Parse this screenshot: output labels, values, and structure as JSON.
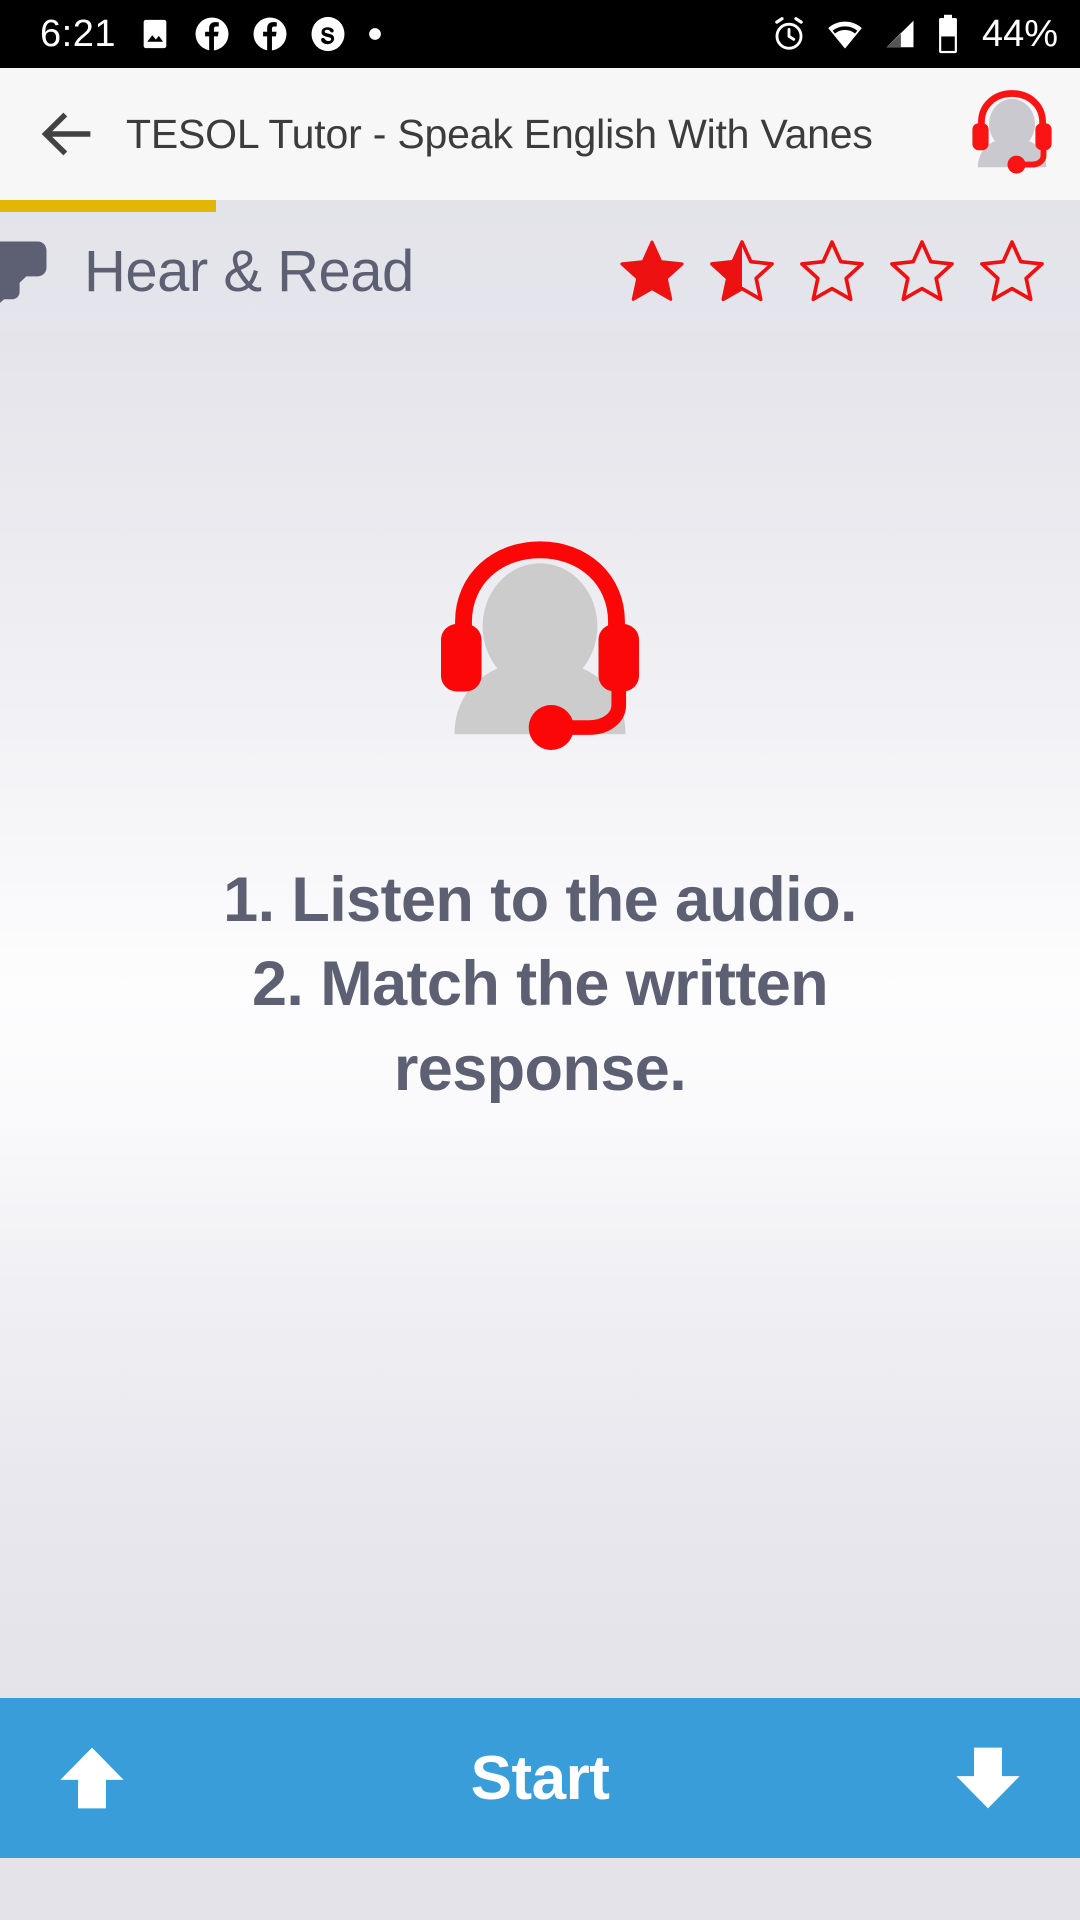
{
  "status_bar": {
    "time": "6:21",
    "battery_percent": "44%",
    "left_icons": [
      "image-icon",
      "facebook-icon",
      "facebook-icon",
      "skype-icon",
      "dot-icon"
    ],
    "right_icons": [
      "alarm-icon",
      "wifi-icon",
      "signal-icon",
      "battery-icon"
    ],
    "background_color": "#000000",
    "foreground_color": "#ffffff"
  },
  "app_bar": {
    "back_icon": "back-arrow-icon",
    "title": "TESOL Tutor - Speak English With Vanes",
    "avatar_icon": "headset-avatar-icon",
    "background_color": "#f7f7f7",
    "title_color": "#3c3c3c"
  },
  "progress": {
    "percent": 20,
    "fill_color": "#e3b505",
    "track_color": "#e3e3e9"
  },
  "section": {
    "icon": "chat-bubbles-icon",
    "title": "Hear & Read",
    "title_color": "#5d5f72",
    "rating": {
      "value": 1.5,
      "max": 5,
      "color": "#ee1111",
      "states": [
        "full",
        "half",
        "empty",
        "empty",
        "empty"
      ]
    }
  },
  "content": {
    "hero_icon": "headset-avatar-icon",
    "instructions": [
      "1. Listen to the audio.",
      "2. Match the written",
      "response."
    ],
    "text_color": "#5d5f72"
  },
  "bottom_bar": {
    "prev_icon": "arrow-up-icon",
    "start_label": "Start",
    "next_icon": "arrow-down-icon",
    "background_color": "#389dd9",
    "label_color": "#ffffff"
  }
}
